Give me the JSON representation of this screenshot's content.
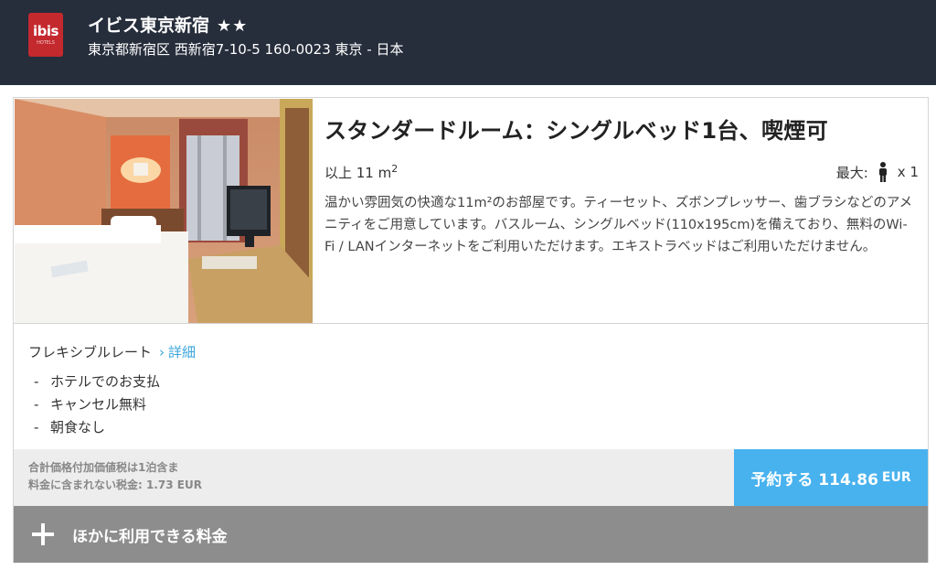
{
  "header": {
    "logo_text": "ibis",
    "logo_sub": "HOTELS",
    "hotel_name": "イビス東京新宿",
    "stars": "★★",
    "address": "東京都新宿区 西新宿7-10-5 160-0023 東京 - 日本",
    "background": "#262d3b"
  },
  "room": {
    "photo_icon": "hotel-room-photo",
    "title": "スタンダードルーム：シングルベッド1台、喫煙可",
    "size_prefix": "以上 11 m",
    "size_unit_sup": "2",
    "max_label": "最大:",
    "max_icon": "person-icon",
    "max_value": "x 1",
    "description": "温かい雰囲気の快適な11m²のお部屋です。ティーセット、ズボンプレッサー、歯ブラシなどのアメニティをご用意しています。バスルーム、シングルベッド(110x195cm)を備えており、無料のWi-Fi / LANインターネットをご利用いただけます。エキストラベッドはご利用いただけません。"
  },
  "rate": {
    "name": "フレキシブルレート",
    "chevron": "›",
    "details_link": "詳細",
    "conditions": [
      "ホテルでのお支払",
      "キャンセル無料",
      "朝食なし"
    ]
  },
  "price": {
    "tax_line1": "合計価格付加価値税は1泊含ま",
    "tax_line2": "料金に含まれない税金: 1.73 EUR",
    "book_label": "予約する 114.86",
    "currency": "EUR",
    "accent": "#48b2ee"
  },
  "more_rates": {
    "icon": "plus-icon",
    "label": "ほかに利用できる料金"
  }
}
